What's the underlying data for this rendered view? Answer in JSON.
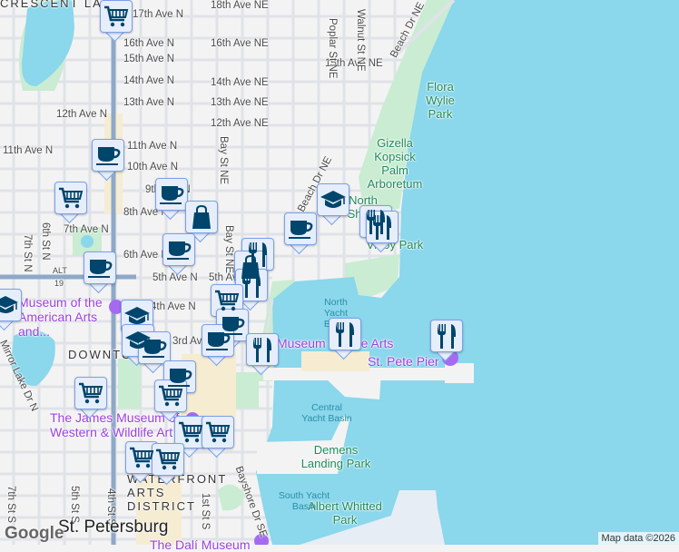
{
  "colors": {
    "water": "#8bd7ec",
    "land": "#f4f3f3",
    "park": "#c9ecd2",
    "road": "#dfe3e8",
    "highway": "#8ea8c8",
    "marker_fill": "#e6eefc",
    "marker_border": "#7ba0e8",
    "icon": "#00456b",
    "poi": "#9a3fe0"
  },
  "labels": {
    "streets": [
      "18th Ave NE",
      "17th Ave N",
      "16th Ave N",
      "16th Ave NE",
      "15th Ave N",
      "15th Ave NE",
      "14th Ave N",
      "14th Ave NE",
      "13th Ave N",
      "13th Ave NE",
      "12th Ave N",
      "12th Ave NE",
      "11th Ave N",
      "11th Ave N",
      "10th Ave N",
      "9th Ave N",
      "8th Ave N",
      "7th Ave N",
      "6th Ave N",
      "5th Ave N",
      "5th Ave N",
      "4th Ave N",
      "3rd Ave N",
      "Bay St NE",
      "Bay St NE",
      "Poplar St NE",
      "Walnut St NE",
      "Beach Dr NE",
      "Beach Dr NE",
      "7th St N",
      "6th St N",
      "Mirror Lake Dr N",
      "7th St S",
      "5th St S",
      "4th St S",
      "1st St S",
      "Bayshore Dr SE"
    ],
    "parks": [
      "Flora Wylie Park",
      "Gizella Kopsick Palm Arboretum",
      "North Shore",
      "Vinoy Park",
      "Demens Landing Park",
      "Albert Whitted Park"
    ],
    "water": [
      "North Yacht Basin",
      "Central Yacht Basin",
      "South Yacht Basin"
    ],
    "pois": [
      "Museum of the American Arts and...",
      "Museum of Fine Arts",
      "St. Pete Pier",
      "The James Museum of Western & Wildlife Art",
      "The Dalí Museum"
    ],
    "districts": [
      "CRESCENT LAKE",
      "DOWNTOWN",
      "WATERFRONT ARTS DISTRICT"
    ],
    "city": "St. Petersburg",
    "shields": [
      "ALT",
      "19"
    ]
  },
  "markers": [
    "cart",
    "coffee",
    "cart",
    "coffee",
    "bag",
    "coffee",
    "coffee",
    "graduation",
    "graduation",
    "coffee",
    "restaurant",
    "restaurant",
    "restaurant",
    "bag",
    "restaurant",
    "cart",
    "graduation",
    "graduation",
    "coffee",
    "coffee",
    "coffee",
    "coffee",
    "restaurant",
    "restaurant",
    "restaurant",
    "cart",
    "cart",
    "cart",
    "cart",
    "cart",
    "cart"
  ],
  "footer": {
    "logo": "Google",
    "attribution": "Map data ©2026"
  }
}
